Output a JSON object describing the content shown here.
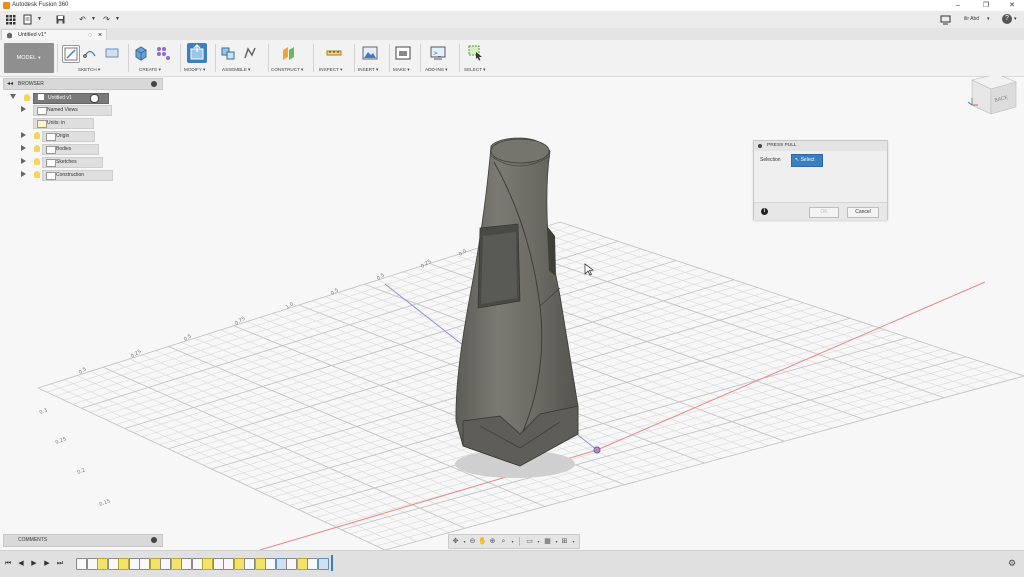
{
  "window": {
    "title": "Autodesk Fusion 360",
    "minimize": "–",
    "restore": "❐",
    "close": "✕"
  },
  "qat": {
    "user_name": "ilir Abd",
    "help": "?"
  },
  "tab": {
    "title": "Untitled v1*",
    "close": "×"
  },
  "toolbar": {
    "workspace": "MODEL",
    "groups": [
      {
        "label": "SKETCH ▾"
      },
      {
        "label": "CREATE ▾"
      },
      {
        "label": "MODIFY ▾"
      },
      {
        "label": "ASSEMBLE ▾"
      },
      {
        "label": "CONSTRUCT ▾"
      },
      {
        "label": "INSPECT ▾"
      },
      {
        "label": "INSERT ▾"
      },
      {
        "label": "MAKE ▾"
      },
      {
        "label": "ADD-INS ▾"
      },
      {
        "label": "SELECT ▾"
      }
    ]
  },
  "browser": {
    "header": "BROWSER",
    "root": "Untitled v1",
    "items": [
      "Named Views",
      "Units: in",
      "Origin",
      "Bodies",
      "Sketches",
      "Construction"
    ]
  },
  "viewcube": {
    "face_right": "BACK"
  },
  "axis_labels": {
    "front": [
      "0.5",
      "0.25",
      "0.5",
      "0.75",
      "1.0",
      "0.5",
      "0.5",
      "0.25",
      "0.0"
    ],
    "side": [
      "0.3",
      "0.25",
      "0.2",
      "0.15"
    ]
  },
  "dialog": {
    "title": "PRESS PULL",
    "selection_label": "Selection",
    "select_button": "Select",
    "info_icon": "i",
    "ok": "OK",
    "cancel": "Cancel"
  },
  "comments": {
    "header": "COMMENTS"
  },
  "colors": {
    "accent_blue": "#3c7fc1",
    "model_gray": "#6b6b65",
    "grid_line": "#d5d5d5",
    "axis_red": "#e07575",
    "axis_blue": "#7b85e0"
  }
}
